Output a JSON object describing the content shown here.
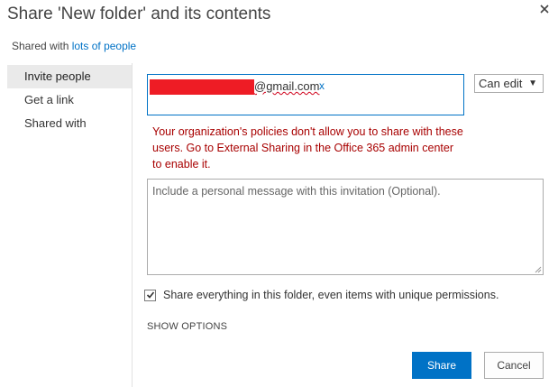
{
  "dialog": {
    "title": "Share 'New folder' and its contents",
    "close_icon": "close-icon"
  },
  "shared_with": {
    "prefix": "Shared with",
    "link_text": "lots of people"
  },
  "nav": {
    "items": [
      {
        "label": "Invite people",
        "active": true
      },
      {
        "label": "Get a link",
        "active": false
      },
      {
        "label": "Shared with",
        "active": false
      }
    ]
  },
  "invite": {
    "email_suffix": "@gmail.com",
    "remove_label": "x",
    "redaction_color": "#ee1c25",
    "permission": "Can edit"
  },
  "error": {
    "text": "Your organization's policies don't allow you to share with these users. Go to External Sharing in the Office 365 admin center to enable it.",
    "color": "#a80000"
  },
  "message": {
    "placeholder": "Include a personal message with this invitation (Optional).",
    "value": ""
  },
  "share_everything": {
    "checked": true,
    "label": "Share everything in this folder, even items with unique permissions."
  },
  "show_options_label": "SHOW OPTIONS",
  "buttons": {
    "share": "Share",
    "cancel": "Cancel",
    "accent": "#0072c6"
  }
}
